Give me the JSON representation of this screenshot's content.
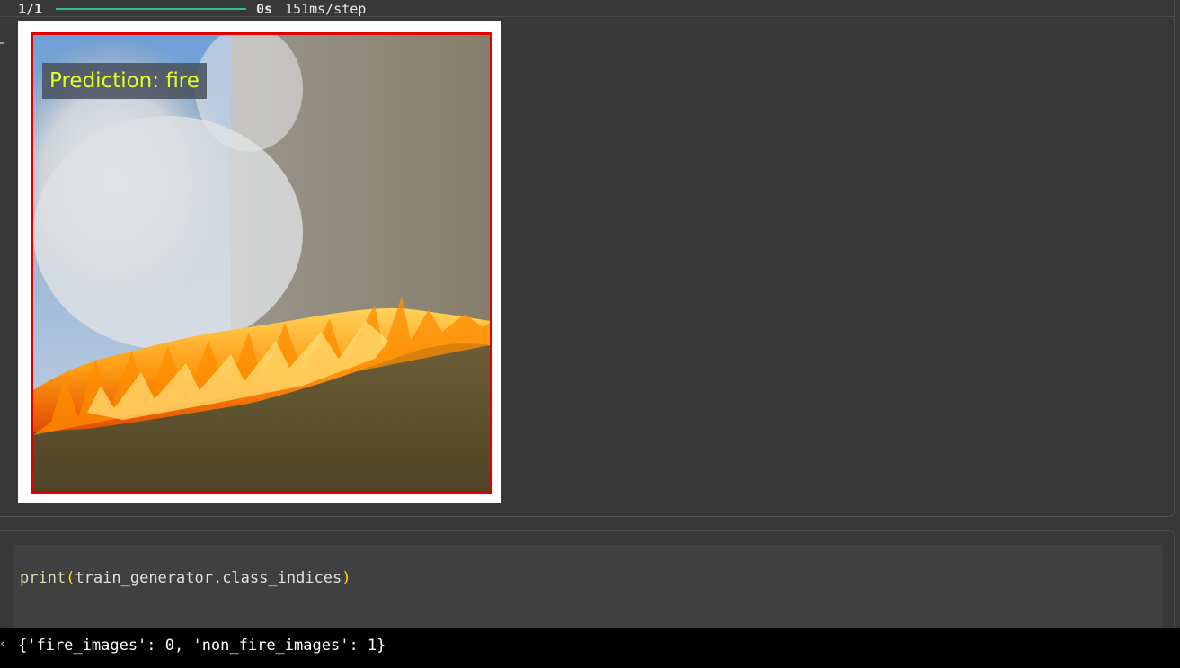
{
  "progress": {
    "step": "1/1",
    "time": "0s",
    "rate": "151ms/step",
    "bar_color": "#27c08a",
    "fraction": 1.0
  },
  "figure": {
    "prediction_label": "Prediction: fire",
    "label_color": "#e6ff26",
    "frame_color": "#e00000",
    "image_subject": "wildfire burning grass with smoke"
  },
  "code_cell": {
    "function": "print",
    "argument": "train_generator.class_indices"
  },
  "output": {
    "text": "{'fire_images': 0, 'non_fire_images': 1}"
  }
}
